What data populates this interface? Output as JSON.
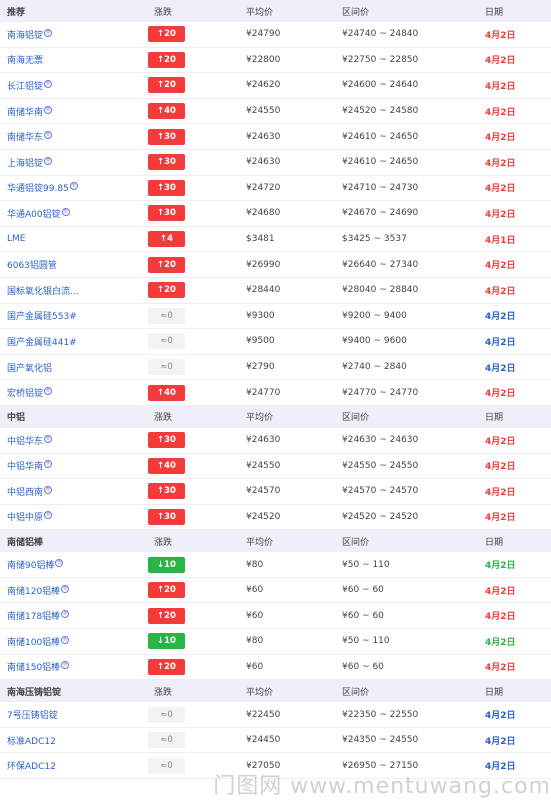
{
  "colors": {
    "up": "#f43b3b",
    "down": "#28b446",
    "flat": "#f3f3f5",
    "date_red": "#f43b3b",
    "date_blue": "#2a62c9",
    "date_green": "#28b446"
  },
  "sections": [
    {
      "header": {
        "name": "推荐",
        "change": "涨跌",
        "avg": "平均价",
        "range": "区间价",
        "date": "日期"
      },
      "rows": [
        {
          "name": "南海铝锭",
          "mark": true,
          "dir": "up",
          "change": "↑20",
          "avg": "¥24790",
          "range": "¥24740 ~ 24840",
          "date": "4月2日",
          "date_color": "red"
        },
        {
          "name": "南海无票",
          "mark": false,
          "dir": "up",
          "change": "↑20",
          "avg": "¥22800",
          "range": "¥22750 ~ 22850",
          "date": "4月2日",
          "date_color": "red"
        },
        {
          "name": "长江铝锭",
          "mark": true,
          "dir": "up",
          "change": "↑20",
          "avg": "¥24620",
          "range": "¥24600 ~ 24640",
          "date": "4月2日",
          "date_color": "red"
        },
        {
          "name": "南储华南",
          "mark": true,
          "dir": "up",
          "change": "↑40",
          "avg": "¥24550",
          "range": "¥24520 ~ 24580",
          "date": "4月2日",
          "date_color": "red"
        },
        {
          "name": "南储华东",
          "mark": true,
          "dir": "up",
          "change": "↑30",
          "avg": "¥24630",
          "range": "¥24610 ~ 24650",
          "date": "4月2日",
          "date_color": "red"
        },
        {
          "name": "上海铝锭",
          "mark": true,
          "dir": "up",
          "change": "↑30",
          "avg": "¥24630",
          "range": "¥24610 ~ 24650",
          "date": "4月2日",
          "date_color": "red"
        },
        {
          "name": "华通铝锭99.85",
          "mark": true,
          "dir": "up",
          "change": "↑30",
          "avg": "¥24720",
          "range": "¥24710 ~ 24730",
          "date": "4月2日",
          "date_color": "red"
        },
        {
          "name": "华通A00铝锭",
          "mark": true,
          "dir": "up",
          "change": "↑30",
          "avg": "¥24680",
          "range": "¥24670 ~ 24690",
          "date": "4月2日",
          "date_color": "red"
        },
        {
          "name": "LME",
          "mark": false,
          "dir": "up",
          "change": "↑4",
          "avg": "$3481",
          "range": "$3425 ~ 3537",
          "date": "4月1日",
          "date_color": "red"
        },
        {
          "name": "6063铝圆管",
          "mark": false,
          "dir": "up",
          "change": "↑20",
          "avg": "¥26990",
          "range": "¥26640 ~ 27340",
          "date": "4月2日",
          "date_color": "red"
        },
        {
          "name": "国标氧化银白流...",
          "mark": false,
          "dir": "up",
          "change": "↑20",
          "avg": "¥28440",
          "range": "¥28040 ~ 28840",
          "date": "4月2日",
          "date_color": "red"
        },
        {
          "name": "国产金属硅553#",
          "mark": false,
          "dir": "flat",
          "change": "≈0",
          "avg": "¥9300",
          "range": "¥9200 ~ 9400",
          "date": "4月2日",
          "date_color": "blue"
        },
        {
          "name": "国产金属硅441#",
          "mark": false,
          "dir": "flat",
          "change": "≈0",
          "avg": "¥9500",
          "range": "¥9400 ~ 9600",
          "date": "4月2日",
          "date_color": "blue"
        },
        {
          "name": "国产氧化铝",
          "mark": false,
          "dir": "flat",
          "change": "≈0",
          "avg": "¥2790",
          "range": "¥2740 ~ 2840",
          "date": "4月2日",
          "date_color": "blue"
        },
        {
          "name": "宏桥铝锭",
          "mark": true,
          "dir": "up",
          "change": "↑40",
          "avg": "¥24770",
          "range": "¥24770 ~ 24770",
          "date": "4月2日",
          "date_color": "red"
        }
      ]
    },
    {
      "header": {
        "name": "中铝",
        "change": "涨跌",
        "avg": "平均价",
        "range": "区间价",
        "date": "日期"
      },
      "rows": [
        {
          "name": "中铝华东",
          "mark": true,
          "dir": "up",
          "change": "↑30",
          "avg": "¥24630",
          "range": "¥24630 ~ 24630",
          "date": "4月2日",
          "date_color": "red"
        },
        {
          "name": "中铝华南",
          "mark": true,
          "dir": "up",
          "change": "↑40",
          "avg": "¥24550",
          "range": "¥24550 ~ 24550",
          "date": "4月2日",
          "date_color": "red"
        },
        {
          "name": "中铝西南",
          "mark": true,
          "dir": "up",
          "change": "↑30",
          "avg": "¥24570",
          "range": "¥24570 ~ 24570",
          "date": "4月2日",
          "date_color": "red"
        },
        {
          "name": "中铝中原",
          "mark": true,
          "dir": "up",
          "change": "↑30",
          "avg": "¥24520",
          "range": "¥24520 ~ 24520",
          "date": "4月2日",
          "date_color": "red"
        }
      ]
    },
    {
      "header": {
        "name": "南储铝棒",
        "change": "涨跌",
        "avg": "平均价",
        "range": "区间价",
        "date": "日期"
      },
      "rows": [
        {
          "name": "南储90铝棒",
          "mark": true,
          "dir": "down",
          "change": "↓10",
          "avg": "¥80",
          "range": "¥50 ~ 110",
          "date": "4月2日",
          "date_color": "green"
        },
        {
          "name": "南储120铝棒",
          "mark": true,
          "dir": "up",
          "change": "↑20",
          "avg": "¥60",
          "range": "¥60 ~ 60",
          "date": "4月2日",
          "date_color": "red"
        },
        {
          "name": "南储178铝棒",
          "mark": true,
          "dir": "up",
          "change": "↑20",
          "avg": "¥60",
          "range": "¥60 ~ 60",
          "date": "4月2日",
          "date_color": "red"
        },
        {
          "name": "南储100铝棒",
          "mark": true,
          "dir": "down",
          "change": "↓10",
          "avg": "¥80",
          "range": "¥50 ~ 110",
          "date": "4月2日",
          "date_color": "green"
        },
        {
          "name": "南储150铝棒",
          "mark": true,
          "dir": "up",
          "change": "↑20",
          "avg": "¥60",
          "range": "¥60 ~ 60",
          "date": "4月2日",
          "date_color": "red"
        }
      ]
    },
    {
      "header": {
        "name": "南海压铸铝锭",
        "change": "涨跌",
        "avg": "平均价",
        "range": "区间价",
        "date": "日期"
      },
      "rows": [
        {
          "name": "7号压铸铝锭",
          "mark": false,
          "dir": "flat",
          "change": "≈0",
          "avg": "¥22450",
          "range": "¥22350 ~ 22550",
          "date": "4月2日",
          "date_color": "blue"
        },
        {
          "name": "标准ADC12",
          "mark": false,
          "dir": "flat",
          "change": "≈0",
          "avg": "¥24450",
          "range": "¥24350 ~ 24550",
          "date": "4月2日",
          "date_color": "blue"
        },
        {
          "name": "环保ADC12",
          "mark": false,
          "dir": "flat",
          "change": "≈0",
          "avg": "¥27050",
          "range": "¥26950 ~ 27150",
          "date": "4月2日",
          "date_color": "blue"
        }
      ]
    }
  ],
  "watermark": "门图网 www.mentuwang.com",
  "mark_glyph": "®"
}
